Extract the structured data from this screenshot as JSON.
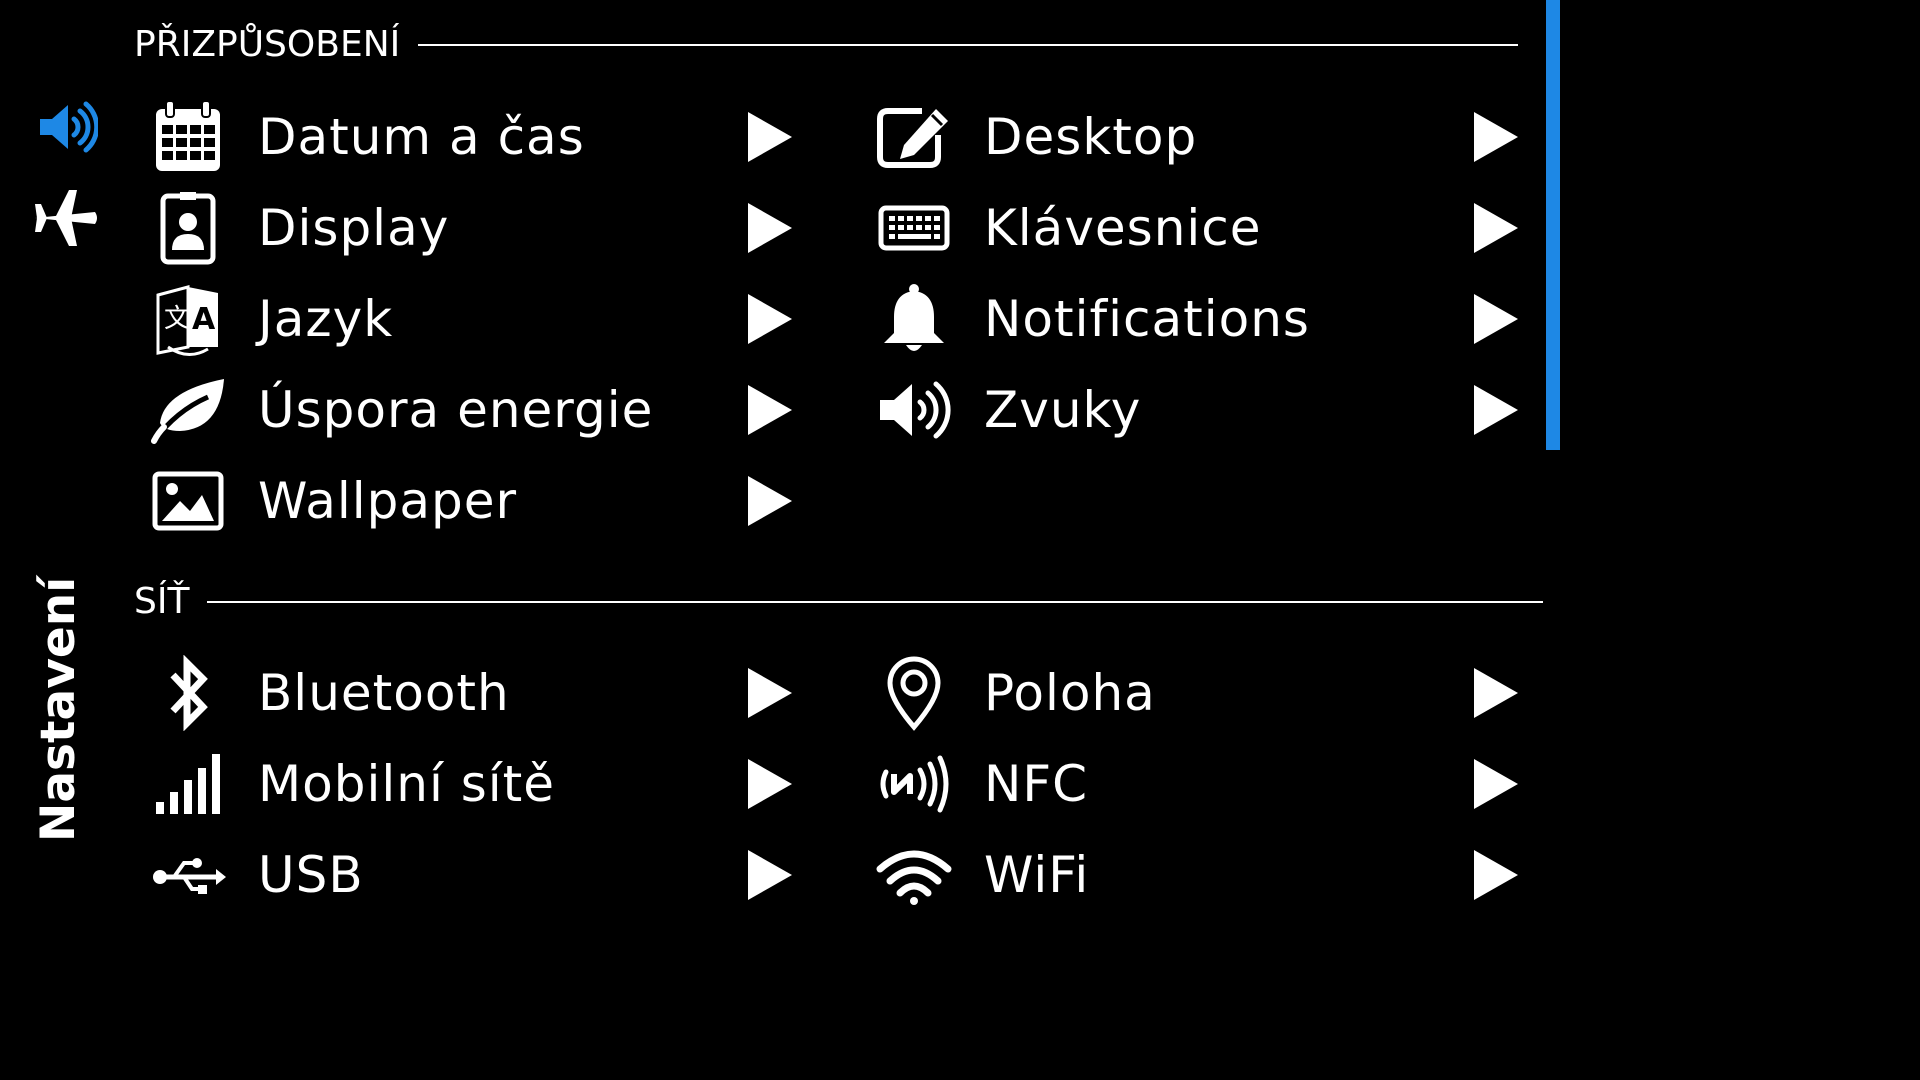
{
  "app": {
    "title": "Nastavení",
    "accent": "#1e88e5"
  },
  "sidebar": {
    "icons": [
      {
        "name": "volume-icon",
        "color": "#1e88e5"
      },
      {
        "name": "airplane-icon",
        "color": "#ffffff"
      }
    ]
  },
  "sections": [
    {
      "title": "PŘIZPŮSOBENÍ",
      "left": [
        {
          "label": "Datum a čas",
          "icon": "calendar-icon"
        },
        {
          "label": "Display",
          "icon": "display-icon"
        },
        {
          "label": "Jazyk",
          "icon": "language-icon"
        },
        {
          "label": "Úspora energie",
          "icon": "leaf-icon"
        },
        {
          "label": "Wallpaper",
          "icon": "image-icon"
        }
      ],
      "right": [
        {
          "label": "Desktop",
          "icon": "edit-icon"
        },
        {
          "label": "Klávesnice",
          "icon": "keyboard-icon"
        },
        {
          "label": "Notifications",
          "icon": "bell-icon"
        },
        {
          "label": "Zvuky",
          "icon": "speaker-icon"
        }
      ]
    },
    {
      "title": "SÍŤ",
      "left": [
        {
          "label": "Bluetooth",
          "icon": "bluetooth-icon"
        },
        {
          "label": "Mobilní sítě",
          "icon": "signal-icon"
        },
        {
          "label": "USB",
          "icon": "usb-icon"
        }
      ],
      "right": [
        {
          "label": "Poloha",
          "icon": "location-icon"
        },
        {
          "label": "NFC",
          "icon": "nfc-icon"
        },
        {
          "label": "WiFi",
          "icon": "wifi-icon"
        }
      ]
    }
  ]
}
